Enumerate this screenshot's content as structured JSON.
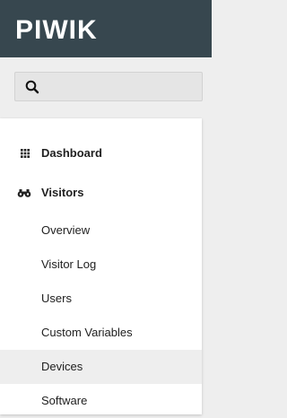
{
  "header": {
    "logo_text": "PIWIK"
  },
  "search": {
    "icon": "search-icon",
    "placeholder": ""
  },
  "menu": {
    "categories": [
      {
        "label": "Dashboard",
        "icon": "grid-icon"
      },
      {
        "label": "Visitors",
        "icon": "binoculars-icon"
      }
    ],
    "visitors_items": [
      {
        "label": "Overview"
      },
      {
        "label": "Visitor Log"
      },
      {
        "label": "Users"
      },
      {
        "label": "Custom Variables"
      },
      {
        "label": "Devices",
        "active": true
      },
      {
        "label": "Software"
      }
    ]
  },
  "colors": {
    "header_bg": "#37474f",
    "page_bg": "#eeeeee",
    "menu_bg": "#ffffff",
    "active_item_bg": "#eeeeee",
    "text": "#212121"
  }
}
